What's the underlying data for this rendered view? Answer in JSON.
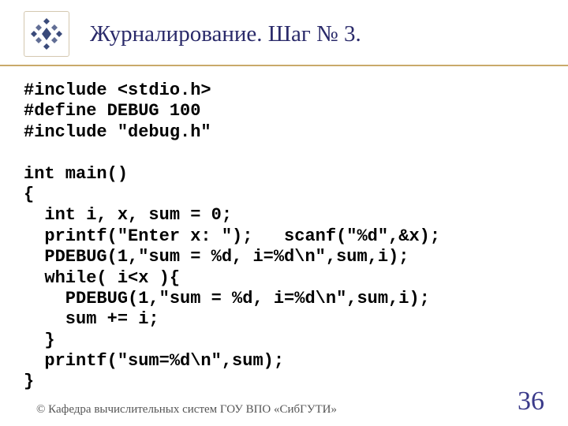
{
  "header": {
    "title": "Журналирование. Шаг № 3."
  },
  "code": "#include <stdio.h>\n#define DEBUG 100\n#include \"debug.h\"\n\nint main()\n{\n  int i, x, sum = 0;\n  printf(\"Enter x: \");   scanf(\"%d\",&x);\n  PDEBUG(1,\"sum = %d, i=%d\\n\",sum,i);\n  while( i<x ){\n    PDEBUG(1,\"sum = %d, i=%d\\n\",sum,i);\n    sum += i;\n  }\n  printf(\"sum=%d\\n\",sum);\n}",
  "footer": {
    "copyright": "© Кафедра вычислительных систем ГОУ ВПО «СибГУТИ»",
    "page": "36"
  }
}
